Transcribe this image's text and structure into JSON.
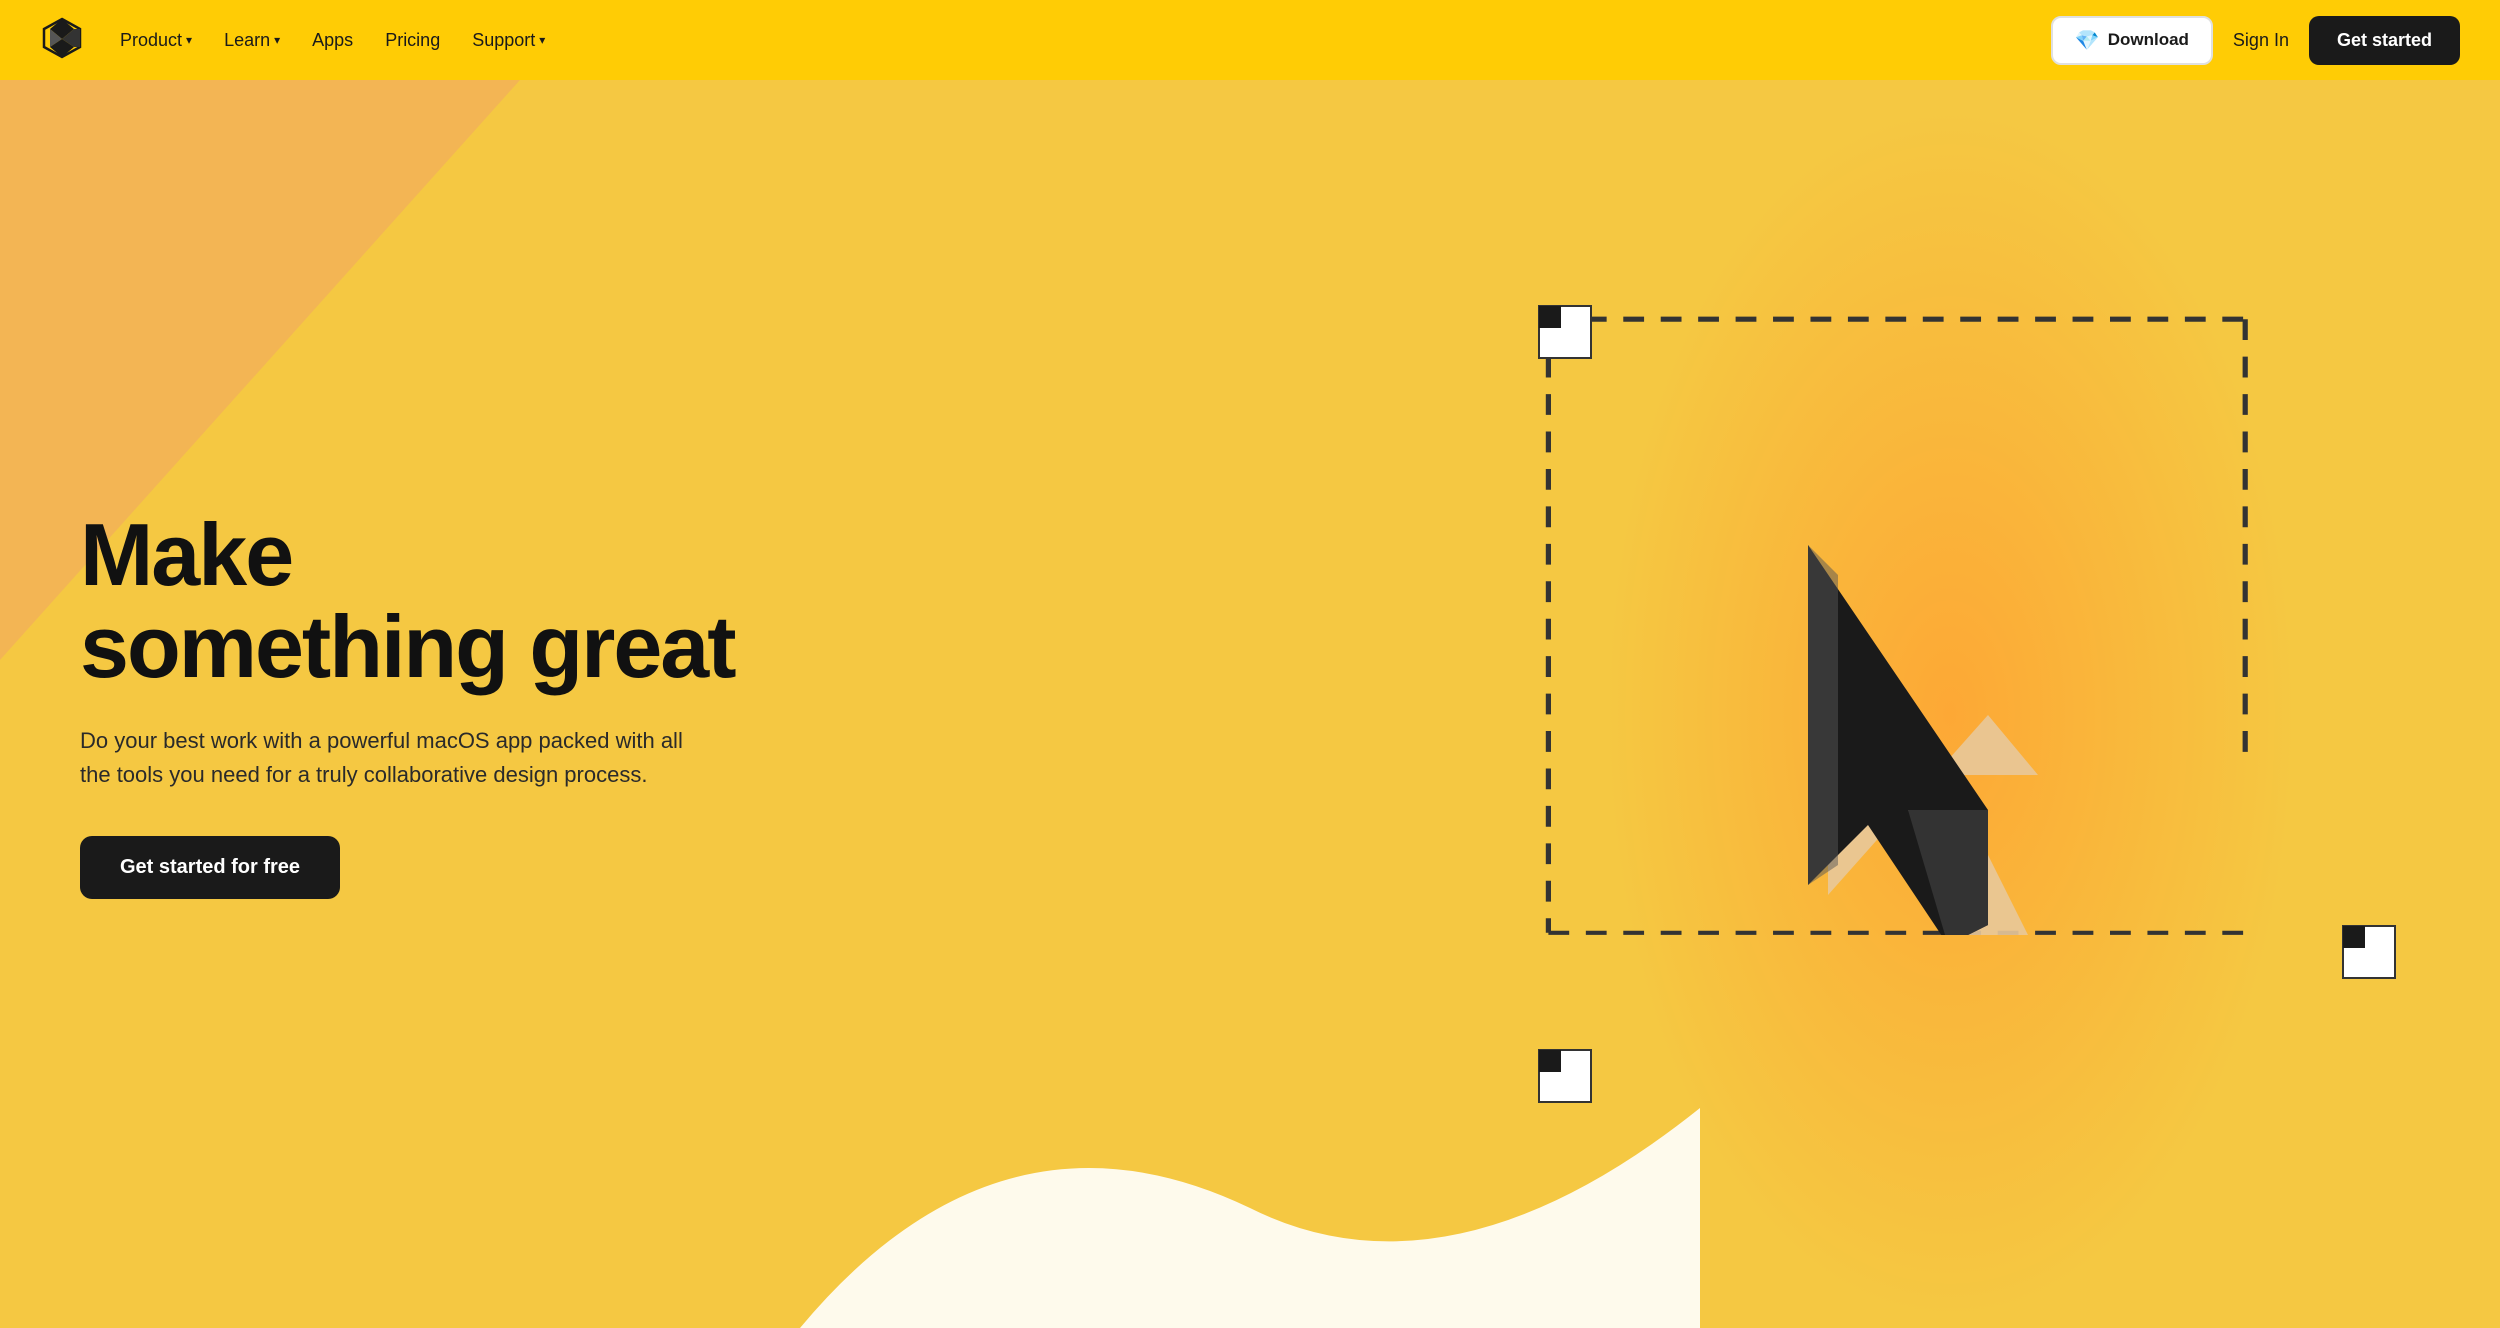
{
  "nav": {
    "logo_alt": "Sketch Logo",
    "links": [
      {
        "label": "Product",
        "has_dropdown": true
      },
      {
        "label": "Learn",
        "has_dropdown": true
      },
      {
        "label": "Apps",
        "has_dropdown": false
      },
      {
        "label": "Pricing",
        "has_dropdown": false
      },
      {
        "label": "Support",
        "has_dropdown": true
      }
    ],
    "download_label": "Download",
    "signin_label": "Sign In",
    "getstarted_label": "Get started"
  },
  "hero": {
    "title_line1": "Make",
    "title_line2": "something great",
    "subtitle": "Do your best work with a powerful macOS app packed with all the tools you need for a truly collaborative design process.",
    "cta_label": "Get started for free"
  },
  "colors": {
    "hero_bg": "#f5c842",
    "hero_glow": "#f5a632",
    "nav_bg": "#f5c842",
    "text_dark": "#111111",
    "btn_dark": "#1a1a1a",
    "btn_light_bg": "#ffffff"
  }
}
